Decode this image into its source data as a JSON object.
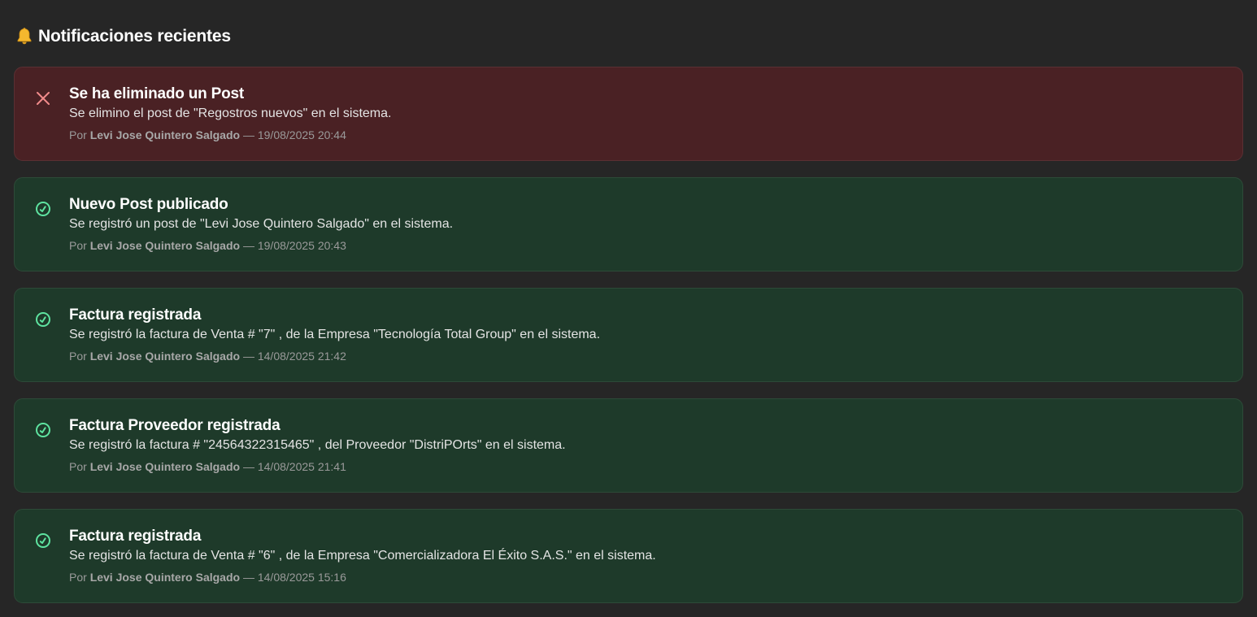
{
  "header": {
    "title": "Notificaciones recientes",
    "icon": "bell-icon"
  },
  "colors": {
    "background": "#262626",
    "error_card": "#4a2124",
    "success_card": "#1e3a2a",
    "error_icon": "#f28b8b",
    "success_icon": "#5ee3a0"
  },
  "notifications": [
    {
      "type": "error",
      "icon": "close-icon",
      "title": "Se ha eliminado un Post",
      "description": "Se elimino el post de \"Regostros nuevos\" en el sistema.",
      "by_label": "Por",
      "author": "Levi Jose Quintero Salgado",
      "separator": "—",
      "datetime": "19/08/2025 20:44"
    },
    {
      "type": "success",
      "icon": "check-circle-icon",
      "title": "Nuevo Post publicado",
      "description": "Se registró un post de \"Levi Jose Quintero Salgado\" en el sistema.",
      "by_label": "Por",
      "author": "Levi Jose Quintero Salgado",
      "separator": "—",
      "datetime": "19/08/2025 20:43"
    },
    {
      "type": "success",
      "icon": "check-circle-icon",
      "title": "Factura registrada",
      "description": "Se registró la factura de Venta # \"7\" , de la Empresa \"Tecnología Total Group\" en el sistema.",
      "by_label": "Por",
      "author": "Levi Jose Quintero Salgado",
      "separator": "—",
      "datetime": "14/08/2025 21:42"
    },
    {
      "type": "success",
      "icon": "check-circle-icon",
      "title": "Factura Proveedor registrada",
      "description": "Se registró la factura # \"24564322315465\" , del Proveedor \"DistriPOrts\" en el sistema.",
      "by_label": "Por",
      "author": "Levi Jose Quintero Salgado",
      "separator": "—",
      "datetime": "14/08/2025 21:41"
    },
    {
      "type": "success",
      "icon": "check-circle-icon",
      "title": "Factura registrada",
      "description": "Se registró la factura de Venta # \"6\" , de la Empresa \"Comercializadora El Éxito S.A.S.\" en el sistema.",
      "by_label": "Por",
      "author": "Levi Jose Quintero Salgado",
      "separator": "—",
      "datetime": "14/08/2025 15:16"
    }
  ]
}
